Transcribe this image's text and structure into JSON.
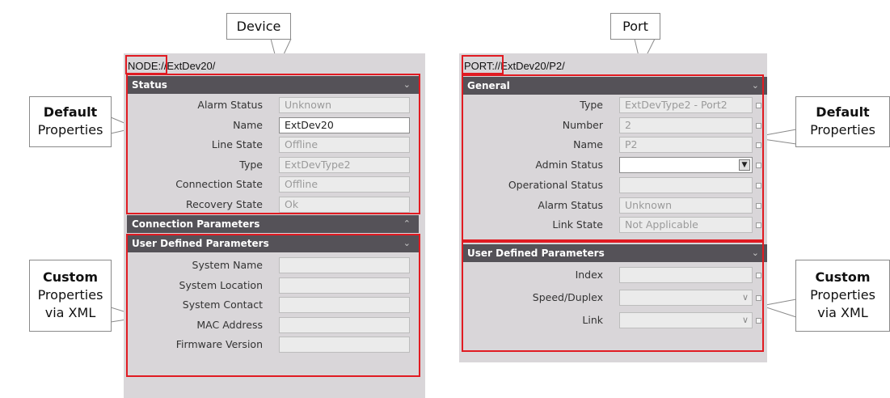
{
  "device": {
    "callout_title": "Device",
    "path_prefix": "NODE:",
    "path_rest": "//ExtDev20/",
    "status_header": "Status",
    "status_rows": [
      {
        "label": "Alarm Status",
        "value": "Unknown"
      },
      {
        "label": "Name",
        "value": "ExtDev20"
      },
      {
        "label": "Line State",
        "value": "Offline"
      },
      {
        "label": "Type",
        "value": "ExtDevType2"
      },
      {
        "label": "Connection State",
        "value": "Offline"
      },
      {
        "label": "Recovery State",
        "value": "Ok"
      }
    ],
    "connection_header": "Connection Parameters",
    "user_header": "User Defined Parameters",
    "user_rows": [
      {
        "label": "System Name",
        "value": ""
      },
      {
        "label": "System Location",
        "value": ""
      },
      {
        "label": "System Contact",
        "value": ""
      },
      {
        "label": "MAC Address",
        "value": ""
      },
      {
        "label": "Firmware Version",
        "value": ""
      }
    ]
  },
  "port": {
    "callout_title": "Port",
    "path_prefix": "PORT:",
    "path_rest": "//ExtDev20/P2/",
    "general_header": "General",
    "general_rows": [
      {
        "label": "Type",
        "value": "ExtDevType2 - Port2"
      },
      {
        "label": "Number",
        "value": "2"
      },
      {
        "label": "Name",
        "value": "P2"
      },
      {
        "label": "Admin Status",
        "value": ""
      },
      {
        "label": "Operational Status",
        "value": ""
      },
      {
        "label": "Alarm Status",
        "value": "Unknown"
      },
      {
        "label": "Link State",
        "value": "Not Applicable"
      }
    ],
    "user_header": "User Defined Parameters",
    "user_rows": [
      {
        "label": "Index",
        "value": ""
      },
      {
        "label": "Speed/Duplex",
        "value": ""
      },
      {
        "label": "Link",
        "value": ""
      }
    ]
  },
  "callouts": {
    "left_default": {
      "bold": "Default",
      "rest": "Properties"
    },
    "right_default": {
      "bold": "Default",
      "rest": "Properties"
    },
    "left_custom": {
      "bold": "Custom",
      "line2": "Properties",
      "line3": "via XML"
    },
    "right_custom": {
      "bold": "Custom",
      "line2": "Properties",
      "line3": "via XML"
    }
  },
  "icons": {
    "collapse": "chevron-down-icon",
    "expand": "chevron-up-icon",
    "dropdown": "dropdown-arrow-icon"
  },
  "colors": {
    "highlight_border": "#e11b22",
    "section_header": "#555258",
    "panel_bg": "#d9d6d9"
  }
}
